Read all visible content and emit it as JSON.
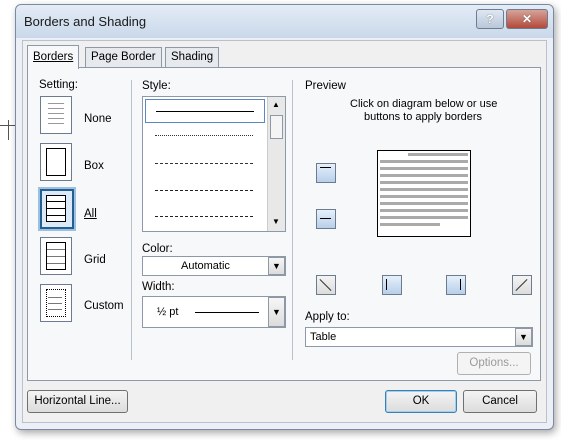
{
  "window": {
    "title": "Borders and Shading",
    "help_glyph": "?",
    "close_glyph": "✕"
  },
  "tabs": [
    {
      "label": "Borders",
      "active": true
    },
    {
      "label": "Page Border",
      "active": false
    },
    {
      "label": "Shading",
      "active": false
    }
  ],
  "setting": {
    "label": "Setting:",
    "options": [
      {
        "label": "None",
        "icon": "setting-none-icon"
      },
      {
        "label": "Box",
        "icon": "setting-box-icon"
      },
      {
        "label": "All",
        "icon": "setting-all-icon",
        "selected": true
      },
      {
        "label": "Grid",
        "icon": "setting-grid-icon"
      },
      {
        "label": "Custom",
        "icon": "setting-custom-icon"
      }
    ]
  },
  "style": {
    "label": "Style:"
  },
  "color": {
    "label": "Color:",
    "value": "Automatic"
  },
  "width": {
    "label": "Width:",
    "value": "½ pt"
  },
  "preview": {
    "label": "Preview",
    "instructions_1": "Click on diagram below or use",
    "instructions_2": "buttons to apply borders"
  },
  "apply_to": {
    "label": "Apply to:",
    "value": "Table"
  },
  "buttons": {
    "options": "Options...",
    "horizontal_line": "Horizontal Line...",
    "ok": "OK",
    "cancel": "Cancel"
  },
  "colors": {
    "accent": "#3c7fb1",
    "selected_border": "#245f8f"
  }
}
